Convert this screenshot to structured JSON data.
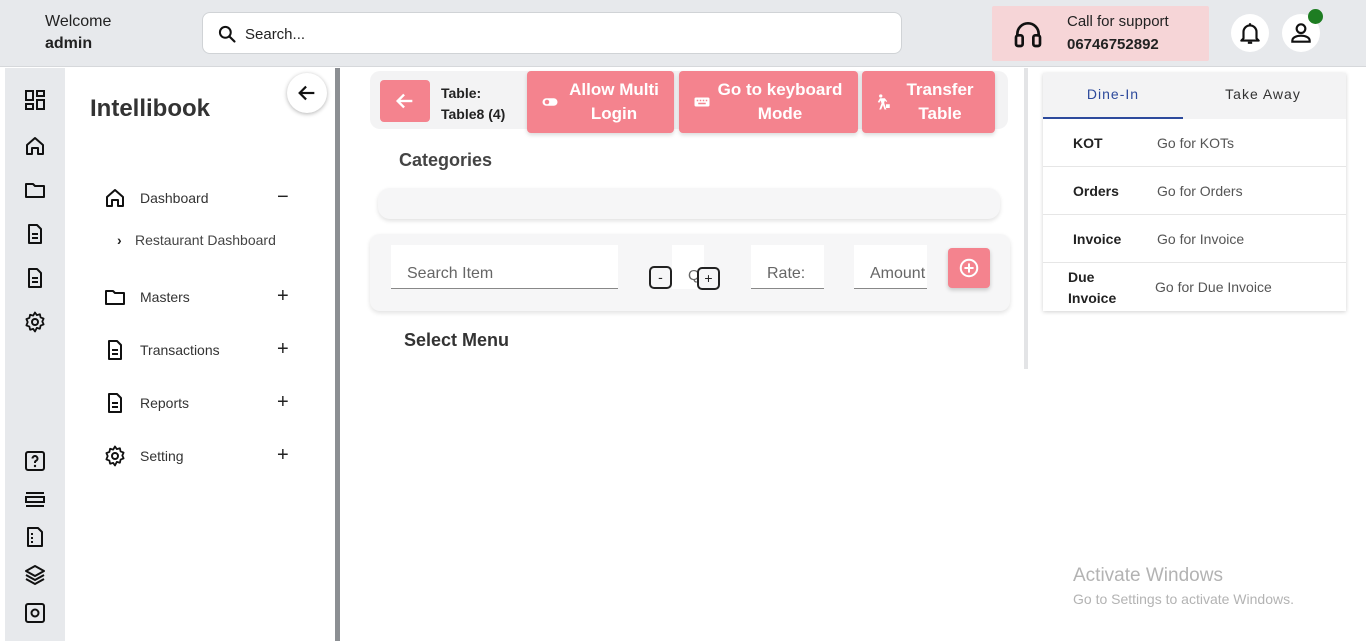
{
  "header": {
    "welcome_label": "Welcome",
    "username": "admin",
    "search_placeholder": "Search...",
    "support_label": "Call for support",
    "support_phone": "06746752892",
    "status_color": "#1e7d22"
  },
  "rail": {
    "icons": [
      "dashboard-icon",
      "home-icon",
      "folder-icon",
      "document-icon",
      "report-icon",
      "settings-icon",
      "help-icon",
      "list-icon",
      "sheet-icon",
      "layers-icon",
      "admin-settings-icon"
    ]
  },
  "sidebar": {
    "brand": "Intellibook",
    "items": [
      {
        "label": "Dashboard",
        "toggle": "−"
      },
      {
        "label": "Masters",
        "toggle": "+"
      },
      {
        "label": "Transactions",
        "toggle": "+"
      },
      {
        "label": "Reports",
        "toggle": "+"
      },
      {
        "label": "Setting",
        "toggle": "+"
      }
    ],
    "subitem": "Restaurant Dashboard"
  },
  "toolbar": {
    "table_label": "Table:",
    "table_value": "Table8 (4)",
    "multi_login": "Allow Multi Login",
    "keyboard_mode": "Go to keyboard Mode",
    "transfer_table": "Transfer Table",
    "accent_color": "#f4838e"
  },
  "main": {
    "categories_title": "Categories",
    "select_menu_title": "Select Menu",
    "search_item_placeholder": "Search Item",
    "qty_placeholder": "Qty",
    "rate_placeholder": "Rate:",
    "amount_placeholder": "Amount",
    "minus_label": "-",
    "plus_label": "+"
  },
  "right_panel": {
    "tabs": [
      "Dine-In",
      "Take Away"
    ],
    "active_tab": "Dine-In",
    "rows": [
      {
        "key": "KOT",
        "value": "Go for KOTs"
      },
      {
        "key": "Orders",
        "value": "Go for Orders"
      },
      {
        "key": "Invoice",
        "value": "Go for Invoice"
      },
      {
        "key": "Due Invoice",
        "value": "Go for Due Invoice"
      }
    ]
  },
  "watermark": {
    "line1": "Activate Windows",
    "line2": "Go to Settings to activate Windows."
  }
}
